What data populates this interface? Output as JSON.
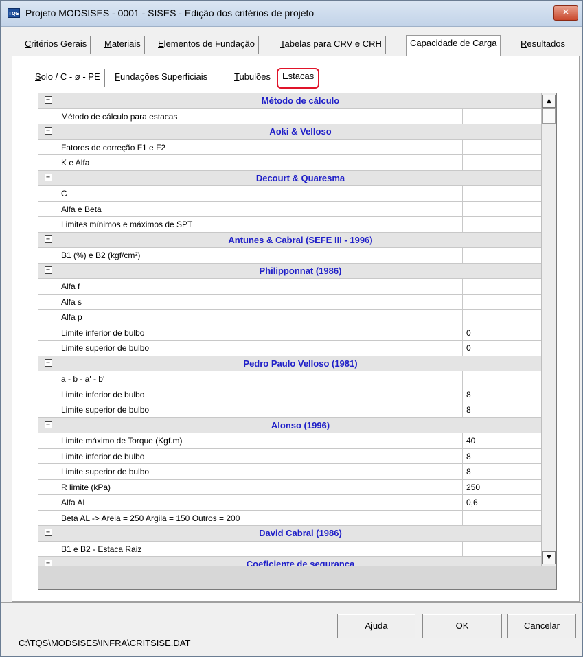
{
  "window": {
    "icon_text": "TQS",
    "title": "Projeto MODSISES - 0001 - SISES - Edição dos critérios de projeto",
    "close_glyph": "✕"
  },
  "tabs": [
    {
      "key": "C",
      "rest": "ritérios Gerais",
      "active": false
    },
    {
      "key": "M",
      "rest": "ateriais",
      "active": false
    },
    {
      "key": "E",
      "rest": "lementos de Fundação",
      "active": false
    },
    {
      "key": "T",
      "rest": "abelas para CRV e CRH",
      "active": false
    },
    {
      "key": "C",
      "rest": "apacidade de Carga",
      "active": true
    },
    {
      "key": "R",
      "rest": "esultados",
      "active": false
    }
  ],
  "subtabs": [
    {
      "key": "S",
      "rest": "olo / C - ø - PE",
      "active": false
    },
    {
      "key": "F",
      "rest": "undações Superficiais",
      "active": false
    },
    {
      "key": "T",
      "rest": "ubulões",
      "active": false
    },
    {
      "key": "E",
      "rest": "stacas",
      "active": true
    }
  ],
  "grid": {
    "toggle_glyph": "−",
    "rows": [
      {
        "type": "group",
        "title": "Método de cálculo"
      },
      {
        "type": "item",
        "label": "Método de cálculo para estacas",
        "value": ""
      },
      {
        "type": "group",
        "title": "Aoki & Velloso"
      },
      {
        "type": "item",
        "label": "Fatores de correção F1 e F2",
        "value": ""
      },
      {
        "type": "item",
        "label": "K e Alfa",
        "value": ""
      },
      {
        "type": "group",
        "title": "Decourt & Quaresma"
      },
      {
        "type": "item",
        "label": "C",
        "value": ""
      },
      {
        "type": "item",
        "label": "Alfa e Beta",
        "value": ""
      },
      {
        "type": "item",
        "label": "Limites mínimos e máximos de SPT",
        "value": ""
      },
      {
        "type": "group",
        "title": "Antunes & Cabral (SEFE III - 1996)"
      },
      {
        "type": "item",
        "label": "B1 (%)  e  B2 (kgf/cm²)",
        "value": ""
      },
      {
        "type": "group",
        "title": "Philipponnat (1986)"
      },
      {
        "type": "item",
        "label": "Alfa f",
        "value": ""
      },
      {
        "type": "item",
        "label": "Alfa s",
        "value": ""
      },
      {
        "type": "item",
        "label": "Alfa p",
        "value": ""
      },
      {
        "type": "item",
        "label": "Limite inferior de bulbo",
        "value": "0"
      },
      {
        "type": "item",
        "label": "Limite superior de bulbo",
        "value": "0"
      },
      {
        "type": "group",
        "title": "Pedro Paulo Velloso (1981)"
      },
      {
        "type": "item",
        "label": "a - b - a' - b'",
        "value": ""
      },
      {
        "type": "item",
        "label": "Limite inferior de bulbo",
        "value": "8"
      },
      {
        "type": "item",
        "label": "Limite superior de bulbo",
        "value": "8"
      },
      {
        "type": "group",
        "title": "Alonso (1996)"
      },
      {
        "type": "item",
        "label": "Limite máximo de Torque (Kgf.m)",
        "value": "40"
      },
      {
        "type": "item",
        "label": "Limite inferior de bulbo",
        "value": "8"
      },
      {
        "type": "item",
        "label": "Limite superior de bulbo",
        "value": "8"
      },
      {
        "type": "item",
        "label": "R limite (kPa)",
        "value": "250"
      },
      {
        "type": "item",
        "label": "Alfa AL",
        "value": "0,6"
      },
      {
        "type": "item",
        "label": "Beta AL    ->    Areia =  250   Argila =  150   Outros =  200",
        "value": ""
      },
      {
        "type": "group",
        "title": "David Cabral (1986)"
      },
      {
        "type": "item",
        "label": "B1 e B2 - Estaca Raiz",
        "value": ""
      },
      {
        "type": "group",
        "title": "Coeficiente de segurança"
      }
    ]
  },
  "scrollbar": {
    "up_glyph": "▲",
    "down_glyph": "▼"
  },
  "buttons": {
    "help": {
      "key": "A",
      "rest": "juda"
    },
    "ok": {
      "key": "O",
      "rest": "K"
    },
    "cancel": {
      "key": "C",
      "rest": "ancelar"
    }
  },
  "status": {
    "path": "C:\\TQS\\MODSISES\\INFRA\\CRITSISE.DAT"
  },
  "colors": {
    "group_title": "#2020c8",
    "highlight": "#e0142a",
    "close_button": "#c9482d"
  }
}
